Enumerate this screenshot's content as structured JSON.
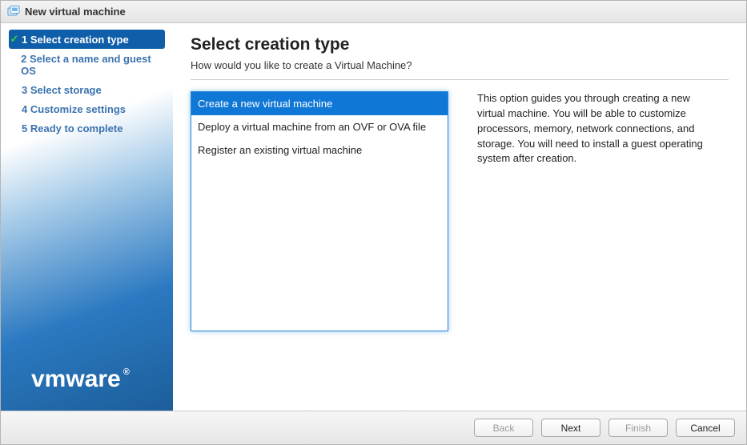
{
  "title": "New virtual machine",
  "sidebar": {
    "steps": [
      {
        "label": "1 Select creation type",
        "active": true
      },
      {
        "label": "2 Select a name and guest OS",
        "active": false
      },
      {
        "label": "3 Select storage",
        "active": false
      },
      {
        "label": "4 Customize settings",
        "active": false
      },
      {
        "label": "5 Ready to complete",
        "active": false
      }
    ],
    "logo": "vmware"
  },
  "main": {
    "heading": "Select creation type",
    "subtitle": "How would you like to create a Virtual Machine?",
    "options": [
      {
        "label": "Create a new virtual machine",
        "selected": true
      },
      {
        "label": "Deploy a virtual machine from an OVF or OVA file",
        "selected": false
      },
      {
        "label": "Register an existing virtual machine",
        "selected": false
      }
    ],
    "description": "This option guides you through creating a new virtual machine. You will be able to customize processors, memory, network connections, and storage. You will need to install a guest operating system after creation."
  },
  "footer": {
    "back": "Back",
    "next": "Next",
    "finish": "Finish",
    "cancel": "Cancel",
    "back_enabled": false,
    "next_enabled": true,
    "finish_enabled": false,
    "cancel_enabled": true
  }
}
